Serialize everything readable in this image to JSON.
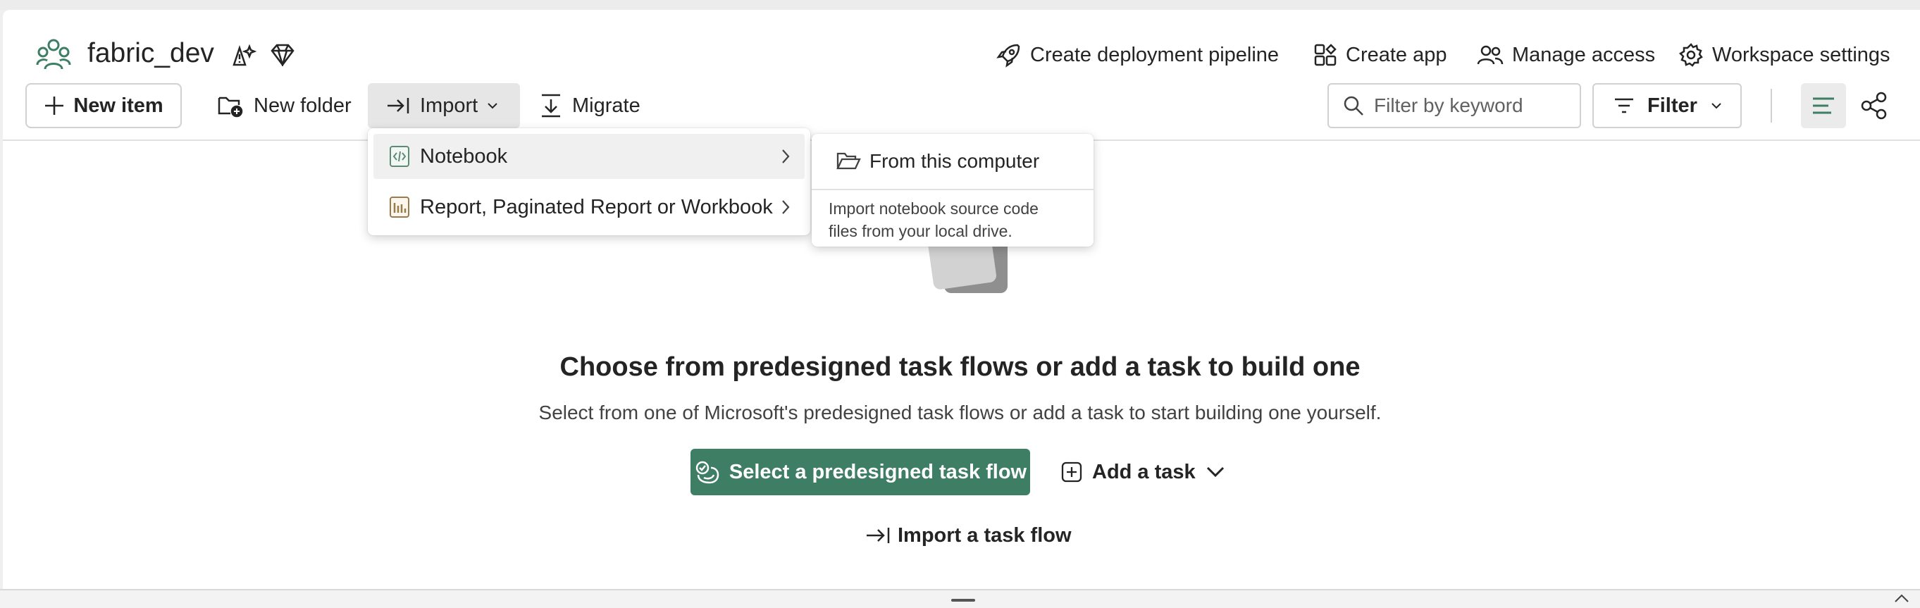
{
  "workspace": {
    "name": "fabric_dev",
    "icon": "workspace-people-icon",
    "badges": [
      "fabric-sparkle-warning-icon",
      "premium-diamond-icon"
    ]
  },
  "header_actions": [
    {
      "label": "Create deployment pipeline",
      "icon": "rocket-icon"
    },
    {
      "label": "Create app",
      "icon": "app-icon"
    },
    {
      "label": "Manage access",
      "icon": "people-icon"
    },
    {
      "label": "Workspace settings",
      "icon": "gear-icon"
    }
  ],
  "toolbar": {
    "new_item": "New item",
    "new_folder": "New folder",
    "import": "Import",
    "migrate": "Migrate",
    "filter_placeholder": "Filter by keyword",
    "filter": "Filter"
  },
  "import_menu": {
    "items": [
      {
        "label": "Notebook",
        "icon": "notebook-icon"
      },
      {
        "label": "Report, Paginated Report or Workbook",
        "icon": "report-icon"
      }
    ],
    "submenu": {
      "item": "From this computer",
      "description_line1": "Import notebook source code",
      "description_line2": "files from your local drive."
    }
  },
  "empty_state": {
    "title": "Choose from predesigned task flows or add a task to build one",
    "subtitle": "Select from one of Microsoft's predesigned task flows or add a task to start building one yourself.",
    "primary_button": "Select a predesigned task flow",
    "add_task": "Add a task",
    "import_flow": "Import a task flow"
  },
  "colors": {
    "accent": "#3e7e64",
    "text": "#242424",
    "border": "#d1d1d1"
  }
}
